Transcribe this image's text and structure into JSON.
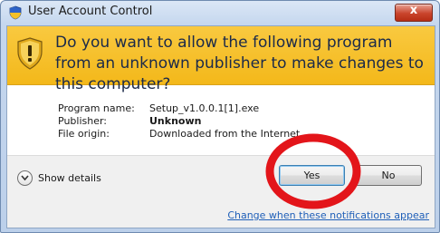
{
  "window": {
    "title": "User Account Control",
    "close_label": "x"
  },
  "banner": {
    "question": "Do you want to allow the following program from an unknown publisher to make changes to this computer?",
    "icon": "warning-shield-icon"
  },
  "details": [
    {
      "label": "Program name:",
      "value": "Setup_v1.0.0.1[1].exe",
      "bold": false
    },
    {
      "label": "Publisher:",
      "value": "Unknown",
      "bold": true
    },
    {
      "label": "File origin:",
      "value": "Downloaded from the Internet",
      "bold": false
    }
  ],
  "footer": {
    "show_details_label": "Show details",
    "yes_label": "Yes",
    "no_label": "No",
    "link_text": "Change when these notifications appear"
  },
  "colors": {
    "banner": "#f3b81a",
    "annotation_circle": "#e3151a",
    "link": "#1f5fb8"
  }
}
